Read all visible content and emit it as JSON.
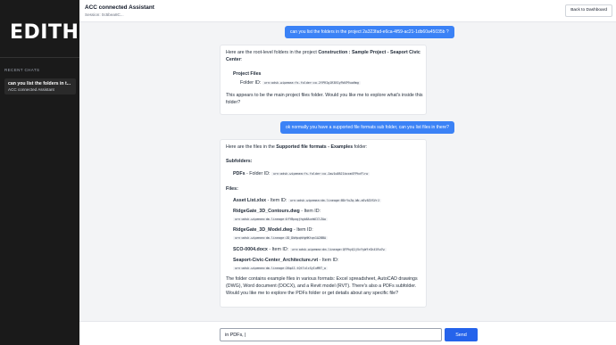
{
  "sidebar": {
    "logo": "EDITH",
    "recent_label": "RECENT CHATS",
    "chats": [
      {
        "title": "can you list the folders in t...",
        "subtitle": "ACC connected Assistant"
      }
    ]
  },
  "header": {
    "title": "ACC connected Assistant",
    "session": "Session: 0c5bea8C...",
    "back_label": "Back to Dashboard"
  },
  "messages": {
    "user1": "can you list the folders in the project 2a323fad-e6ca-4f59-ac21-1db60a45035b ?",
    "bot1": {
      "intro_pre": "Here are the root-level folders in the project ",
      "intro_bold": "Construction : Sample Project - Seaport Civic Center",
      "intro_post": ":",
      "folder_name": "Project Files",
      "folder_id_label": "Folder ID:",
      "folder_id": "urn:adsk.wipemea:fs.folder:co.2YPRIg1R3EGyFWXP9uaHmg",
      "outro": "This appears to be the main project files folder. Would you like me to explore what's inside this folder?"
    },
    "user2": "ok normally you have a supported file formats sub folder, can you list files in there?",
    "bot2": {
      "intro_pre": "Here are the files in the ",
      "intro_bold": "Supported file formats - Examples",
      "intro_post": " folder:",
      "subfolders_heading": "Subfolders:",
      "subfolder_name": "PDFs",
      "subfolder_id_label": " - Folder ID: ",
      "subfolder_id": "urn:adsk.wipemea:fs.folder:co.Jaw1u0BJ1bcxmXFPhvFlrw",
      "files_heading": "Files:",
      "files": [
        {
          "name": "Asset List.xlsx",
          "label": " - Item ID: ",
          "id": "urn:adsk.wipemea:dm.lineage:BDrYuZq-Wb-aEv8ZVSVrJ"
        },
        {
          "name": "RidgeGate_3D_Contours.dwg",
          "label": " - Item ID: ",
          "id": "urn:adsk.wipemea:dm.lineage:UfYBpxgjhgb8AunWCClZAw"
        },
        {
          "name": "RidgeGate_3D_Model.dwg",
          "label": " - Item ID: ",
          "id": "urn:adsk.wipemea:dm.lineage:JD_DbHpqhHgHKtqn1A2BBA"
        },
        {
          "name": "SCO-0004.docx",
          "label": " - Item ID: ",
          "id": "urn:adsk.wipemea:dm.lineage:QFPhyQ1jVcYyWfrGh4lRu7w"
        },
        {
          "name": "Seaport-Civic-Center_Architecture.rvt",
          "label": " - Item ID: ",
          "id": "urn:adsk.wipemea:dm.lineage:2KqAI-tQt7ulcSyIuMRT_w"
        }
      ],
      "outro": "The folder contains example files in various formats: Excel spreadsheet, AutoCAD drawings (DWG), Word document (DOCX), and a Revit model (RVT). There's also a PDFs subfolder. Would you like me to explore the PDFs folder or get details about any specific file?"
    }
  },
  "composer": {
    "value": "in PDFs, |",
    "send_label": "Send"
  },
  "colors": {
    "accent": "#3b82f6",
    "sidebar_bg": "#1a1a1a",
    "send": "#2563eb"
  }
}
